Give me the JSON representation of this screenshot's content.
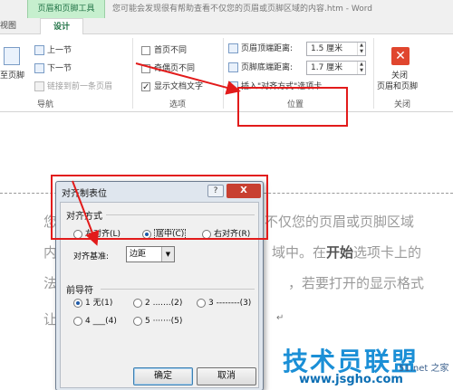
{
  "title_bar": {
    "context_tab": "页眉和页脚工具",
    "document_title": "您可能会发现很有帮助查看不仅您的页眉或页脚区域的内容.htm - Word"
  },
  "tabs": {
    "left_partial": "视图",
    "active": "设计"
  },
  "ribbon": {
    "goto_footer": "至页脚",
    "prev_section": "上一节",
    "next_section": "下一节",
    "link_previous": "链接到前一条页眉",
    "group_nav": "导航",
    "diff_first_page": "首页不同",
    "diff_odd_even": "奇偶页不同",
    "show_doc_text": "显示文档文字",
    "group_options": "选项",
    "header_top_label": "页眉顶端距离:",
    "header_top_value": "1.5 厘米",
    "footer_bottom_label": "页脚底端距离:",
    "footer_bottom_value": "1.7 厘米",
    "insert_align_tab": "插入\"对齐方式\"选项卡",
    "group_position": "位置",
    "close_label_1": "关闭",
    "close_label_2": "页眉和页脚",
    "group_close": "关闭"
  },
  "document": {
    "line1_left": "您",
    "line1_right": "不仅您的页眉或页脚区域",
    "line2_left": "内",
    "line2_mid": "域中。在",
    "line2_bold": "开始",
    "line2_right": "选项卡上的",
    "line3_left": "法",
    "line3_right": "，若要打开的显示格式",
    "line4_left": "让",
    "para_mark": "↵"
  },
  "dialog": {
    "title": "对齐制表位",
    "help": "?",
    "close": "X",
    "alignment_section": "对齐方式",
    "align_left": "左对齐(L)",
    "align_center": "居中(C)",
    "align_right": "右对齐(R)",
    "align_base_label": "对齐基准:",
    "align_base_value": "边距",
    "leader_section": "前导符",
    "leader_1": "1 无(1)",
    "leader_2": "2 .......(2)",
    "leader_3": "3 --------(3)",
    "leader_4": "4 ___(4)",
    "leader_5": "5 ·······(5)",
    "ok": "确定",
    "cancel": "取消"
  },
  "watermark": {
    "brand": "技术员联盟",
    "url": "www.jsgho.com",
    "side": "51.net 之家"
  },
  "colors": {
    "accent_green": "#217346",
    "annotation_red": "#e21b1b",
    "watermark_blue": "#1b8fd6"
  }
}
